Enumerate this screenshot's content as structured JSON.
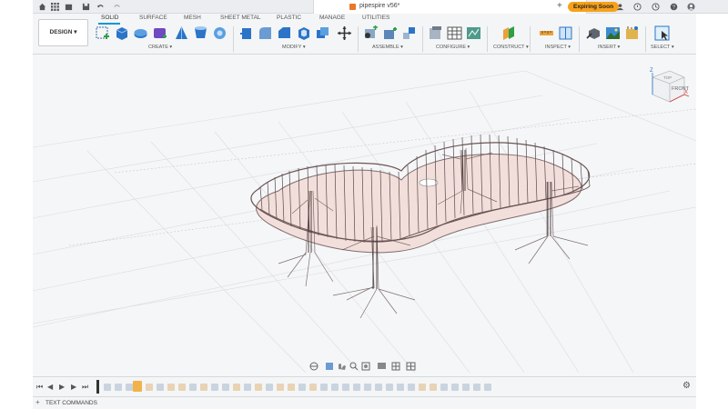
{
  "titlebar": {
    "doc_title": "pipespire v56*",
    "expiring_label": "Expiring Soon"
  },
  "toolbar": {
    "design_label": "DESIGN ▾",
    "tabs": [
      "SOLID",
      "SURFACE",
      "MESH",
      "SHEET METAL",
      "PLASTIC",
      "MANAGE",
      "UTILITIES"
    ],
    "groups": [
      "CREATE ▾",
      "MODIFY ▾",
      "ASSEMBLE ▾",
      "CONFIGURE ▾",
      "CONSTRUCT ▾",
      "INSPECT ▾",
      "INSERT ▾",
      "SELECT ▾"
    ]
  },
  "viewcube": {
    "front_label": "FRONT",
    "top_label": "TOP",
    "axis_x": "X",
    "axis_z": "Z"
  },
  "bottom": {
    "text_commands_label": "TEXT COMMANDS"
  },
  "colors": {
    "accent": "#0696d7",
    "expiring_bg": "#f7a11b",
    "model_stroke": "#5a4a4a",
    "model_fill": "#f2dcd6"
  }
}
